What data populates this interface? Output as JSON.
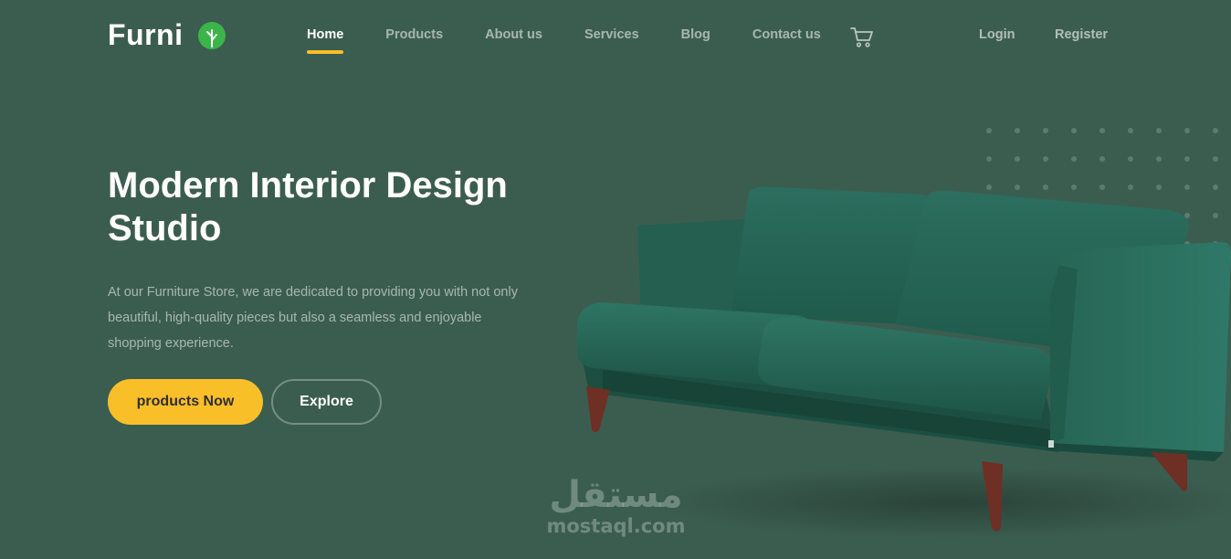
{
  "brand": {
    "name": "Furni",
    "logo_icon": "leaf-icon",
    "accent_color": "#f9bf29",
    "bg_color": "#3b5d50"
  },
  "nav": {
    "items": [
      {
        "label": "Home",
        "active": true
      },
      {
        "label": "Products"
      },
      {
        "label": "About us"
      },
      {
        "label": "Services"
      },
      {
        "label": "Blog"
      },
      {
        "label": "Contact us"
      }
    ],
    "cart_icon": "cart-icon",
    "login": "Login",
    "register": "Register"
  },
  "hero": {
    "title": "Modern Interior Design Studio",
    "description": "At our Furniture Store, we are dedicated to providing you with not only beautiful, high-quality pieces but also a seamless and enjoyable shopping experience.",
    "primary_button": "products Now",
    "secondary_button": "Explore"
  },
  "watermark": {
    "arabic": "مستقل",
    "latin": "mostaql.com"
  }
}
